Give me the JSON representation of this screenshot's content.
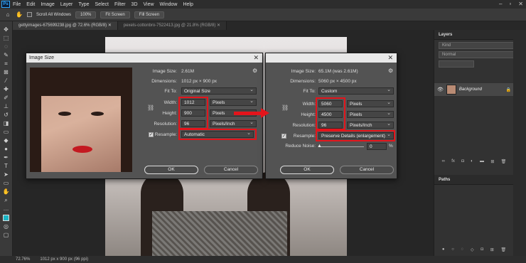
{
  "menubar": {
    "logo": "Ps",
    "items": [
      "File",
      "Edit",
      "Image",
      "Layer",
      "Type",
      "Select",
      "Filter",
      "3D",
      "View",
      "Window",
      "Help"
    ]
  },
  "options": {
    "scroll_all_windows": "Scroll All Windows",
    "zoom": "100%",
    "fit_screen": "Fit Screen",
    "fill_screen": "Fill Screen"
  },
  "tabs": [
    {
      "label": "gettyimages-675699238.jpg @ 72.6% (RGB/8)"
    },
    {
      "label": "pexels-cottonbro-7522413.jpg @ 21.8% (RGB/8)"
    }
  ],
  "status": {
    "zoom": "72.76%",
    "doc_size": "1012 px x 900 px (96 ppi)"
  },
  "layers_panel": {
    "title": "Layers",
    "kind_placeholder": "Kind",
    "blend_mode": "Normal",
    "layer_name": "Background",
    "paths_title": "Paths"
  },
  "dialog_left": {
    "title": "Image Size",
    "image_size_label": "Image Size:",
    "image_size_value": "2.61M",
    "dimensions_label": "Dimensions:",
    "dimensions_value": "1012 px  ×  900 px",
    "fit_to_label": "Fit To:",
    "fit_to_value": "Original Size",
    "width_label": "Width:",
    "width_value": "1012",
    "width_unit": "Pixels",
    "height_label": "Height:",
    "height_value": "900",
    "height_unit": "Pixels",
    "resolution_label": "Resolution:",
    "resolution_value": "96",
    "resolution_unit": "Pixels/Inch",
    "resample_label": "Resample:",
    "resample_value": "Automatic",
    "ok": "OK",
    "cancel": "Cancel"
  },
  "dialog_right": {
    "image_size_label": "Image Size:",
    "image_size_value": "65.1M (was 2.61M)",
    "dimensions_label": "Dimensions:",
    "dimensions_value": "5060 px  ×  4500 px",
    "fit_to_label": "Fit To:",
    "fit_to_value": "Custom",
    "width_label": "Width:",
    "width_value": "5060",
    "width_unit": "Pixels",
    "height_label": "Height:",
    "height_value": "4500",
    "height_unit": "Pixels",
    "resolution_label": "Resolution:",
    "resolution_value": "96",
    "resolution_unit": "Pixels/Inch",
    "resample_label": "Resample:",
    "resample_value": "Preserve Details (enlargement)",
    "reduce_noise_label": "Reduce Noise:",
    "reduce_noise_value": "0",
    "reduce_noise_unit": "%",
    "ok": "OK",
    "cancel": "Cancel"
  },
  "colors": {
    "highlight": "#e3141b",
    "foreground_swatch": "#1bb6c6"
  }
}
